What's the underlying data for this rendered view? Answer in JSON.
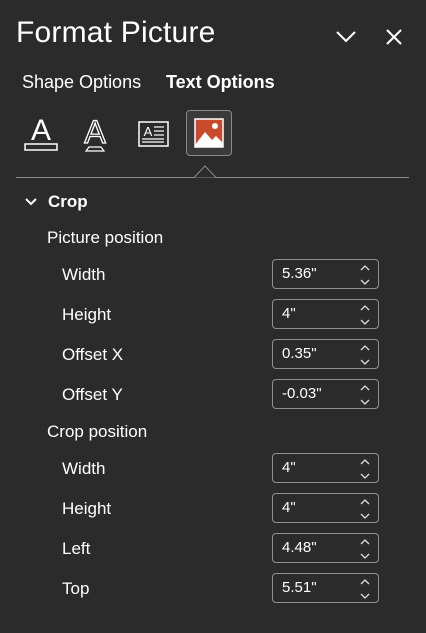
{
  "header": {
    "title": "Format Picture"
  },
  "tabs": {
    "shape_options": "Shape Options",
    "text_options": "Text Options"
  },
  "icons": [
    "text-fill-icon",
    "text-outline-icon",
    "text-box-icon",
    "picture-icon"
  ],
  "crop": {
    "section_label": "Crop",
    "picture_position_label": "Picture position",
    "picture_fields": [
      {
        "label": "Width",
        "value": "5.36\""
      },
      {
        "label": "Height",
        "value": "4\""
      },
      {
        "label": "Offset X",
        "value": "0.35\""
      },
      {
        "label": "Offset Y",
        "value": "-0.03\""
      }
    ],
    "crop_position_label": "Crop position",
    "crop_fields": [
      {
        "label": "Width",
        "value": "4\""
      },
      {
        "label": "Height",
        "value": "4\""
      },
      {
        "label": "Left",
        "value": "4.48\""
      },
      {
        "label": "Top",
        "value": "5.51\""
      }
    ]
  },
  "colors": {
    "background": "#2b2b2b",
    "accent": "#c84b2e",
    "border": "#8f8f8f"
  }
}
